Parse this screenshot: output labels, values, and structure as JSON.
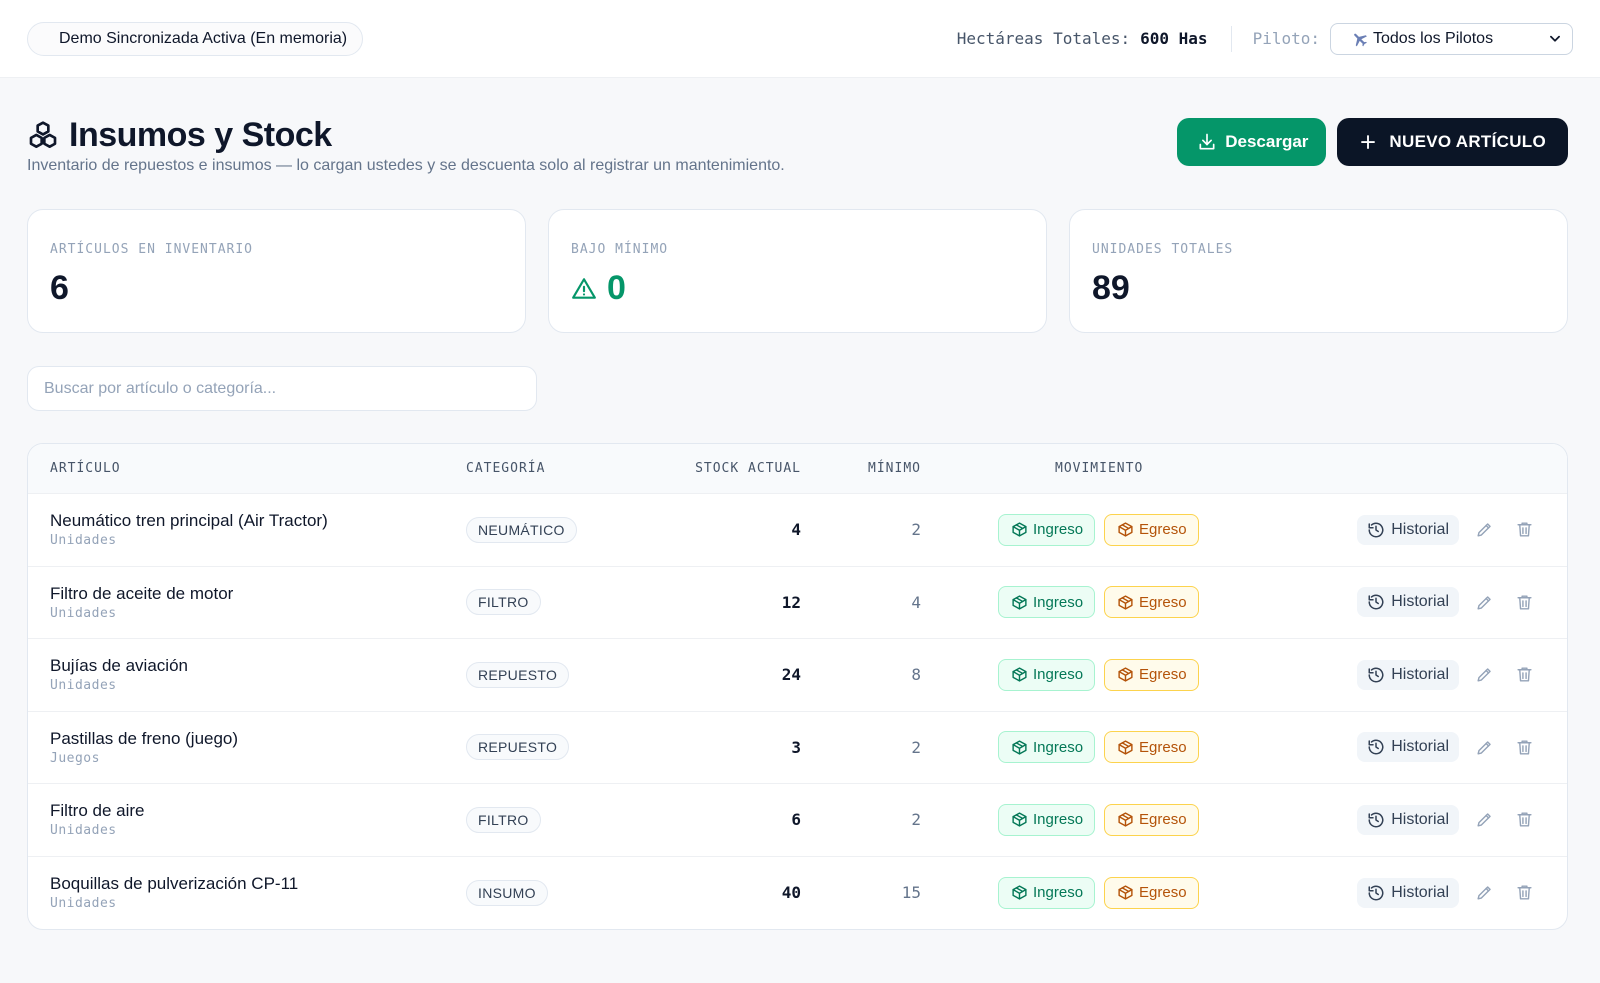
{
  "topbar": {
    "demo_label": "Demo Sincronizada Activa (En memoria)",
    "hectares_label": "Hectáreas Totales:",
    "hectares_value": "600 Has",
    "pilot_label": "Piloto:",
    "pilot_selected": "Todos los Pilotos"
  },
  "header": {
    "title": "Insumos y Stock",
    "subtitle": "Inventario de repuestos e insumos — lo cargan ustedes y se descuenta solo al registrar un mantenimiento.",
    "download_label": "Descargar",
    "new_label": "NUEVO ARTÍCULO"
  },
  "stats": [
    {
      "label": "ARTÍCULOS EN INVENTARIO",
      "value": "6"
    },
    {
      "label": "BAJO MÍNIMO",
      "value": "0"
    },
    {
      "label": "UNIDADES TOTALES",
      "value": "89"
    }
  ],
  "search": {
    "placeholder": "Buscar por artículo o categoría...",
    "value": ""
  },
  "table": {
    "headers": {
      "article": "ARTÍCULO",
      "category": "CATEGORÍA",
      "stock": "STOCK ACTUAL",
      "min": "MÍNIMO",
      "movement": "MOVIMIENTO"
    },
    "labels": {
      "in": "Ingreso",
      "out": "Egreso",
      "history": "Historial"
    },
    "rows": [
      {
        "name": "Neumático tren principal (Air Tractor)",
        "unit": "Unidades",
        "category": "NEUMÁTICO",
        "stock": "4",
        "min": "2"
      },
      {
        "name": "Filtro de aceite de motor",
        "unit": "Unidades",
        "category": "FILTRO",
        "stock": "12",
        "min": "4"
      },
      {
        "name": "Bujías de aviación",
        "unit": "Unidades",
        "category": "REPUESTO",
        "stock": "24",
        "min": "8"
      },
      {
        "name": "Pastillas de freno (juego)",
        "unit": "Juegos",
        "category": "REPUESTO",
        "stock": "3",
        "min": "2"
      },
      {
        "name": "Filtro de aire",
        "unit": "Unidades",
        "category": "FILTRO",
        "stock": "6",
        "min": "2"
      },
      {
        "name": "Boquillas de pulverización CP-11",
        "unit": "Unidades",
        "category": "INSUMO",
        "stock": "40",
        "min": "15"
      }
    ]
  },
  "colors": {
    "accent_green": "#059669",
    "dark_button": "#0b1526",
    "amber": "#b45309"
  }
}
